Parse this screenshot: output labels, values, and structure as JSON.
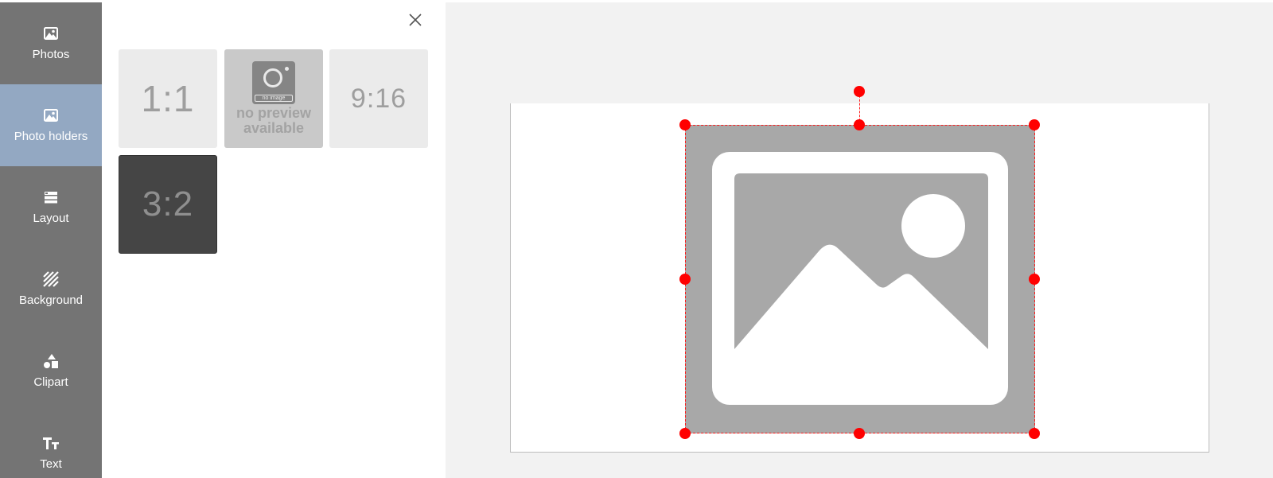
{
  "sidebar": {
    "items": [
      {
        "label": "Photos",
        "icon": "image-icon",
        "active": false
      },
      {
        "label": "Photo holders",
        "icon": "image-icon",
        "active": true
      },
      {
        "label": "Layout",
        "icon": "layout-icon",
        "active": false
      },
      {
        "label": "Background",
        "icon": "stripes-icon",
        "active": false
      },
      {
        "label": "Clipart",
        "icon": "shapes-icon",
        "active": false
      },
      {
        "label": "Text",
        "icon": "text-size-icon",
        "active": false
      }
    ],
    "colors": {
      "background": "#747474",
      "active": "#93a8c2"
    }
  },
  "panel": {
    "close_icon": "close-icon",
    "tiles": [
      {
        "label": "1:1",
        "style": "light"
      },
      {
        "label": "no preview available",
        "line1": "no preview",
        "line2": "available",
        "cam_caption": "no image",
        "style": "no-preview"
      },
      {
        "label": "9:16",
        "style": "light"
      },
      {
        "label": "3:2",
        "style": "dark"
      }
    ]
  },
  "workspace": {
    "background": "#f2f2f2",
    "selection_color": "#ff0000",
    "placeholder_icon": "image-placeholder-icon"
  }
}
